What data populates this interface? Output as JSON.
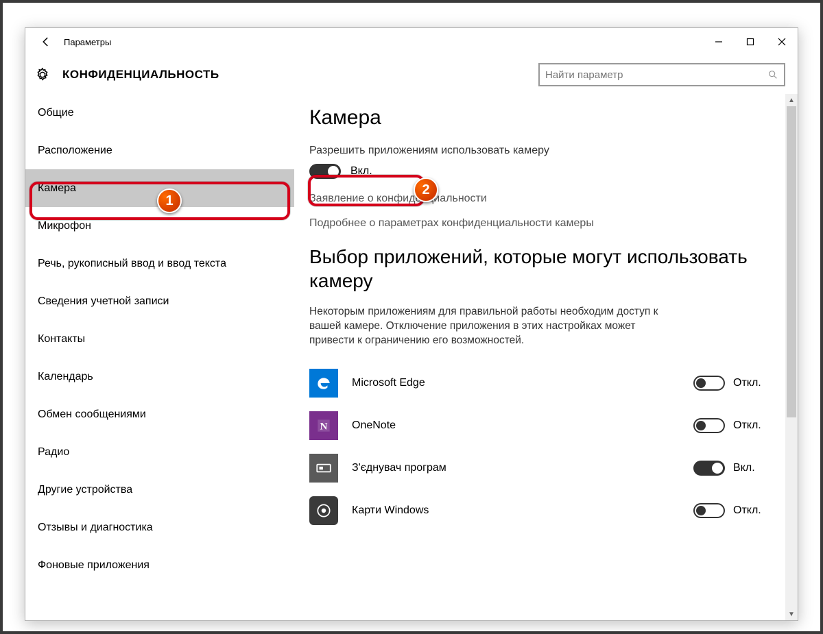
{
  "titlebar": {
    "title": "Параметры"
  },
  "header": {
    "page_title": "КОНФИДЕНЦИАЛЬНОСТЬ",
    "search_placeholder": "Найти параметр"
  },
  "sidebar": {
    "items": [
      {
        "label": "Общие"
      },
      {
        "label": "Расположение"
      },
      {
        "label": "Камера"
      },
      {
        "label": "Микрофон"
      },
      {
        "label": "Речь, рукописный ввод и ввод текста"
      },
      {
        "label": "Сведения учетной записи"
      },
      {
        "label": "Контакты"
      },
      {
        "label": "Календарь"
      },
      {
        "label": "Обмен сообщениями"
      },
      {
        "label": "Радио"
      },
      {
        "label": "Другие устройства"
      },
      {
        "label": "Отзывы и диагностика"
      },
      {
        "label": "Фоновые приложения"
      }
    ],
    "selected_index": 2
  },
  "content": {
    "heading": "Камера",
    "allow_label": "Разрешить приложениям использовать камеру",
    "allow_state_label": "Вкл.",
    "allow_state_on": true,
    "privacy_stmt": "Заявление о конфиденциальности",
    "more_info": "Подробнее о параметрах конфиденциальности камеры",
    "section2_heading": "Выбор приложений, которые могут использовать камеру",
    "section2_desc": "Некоторым приложениям для правильной работы необходим доступ к вашей камере. Отключение приложения в этих настройках может привести к ограничению его возможностей.",
    "apps": [
      {
        "name": "Microsoft Edge",
        "icon": "edge",
        "on": false,
        "state_label": "Откл."
      },
      {
        "name": "OneNote",
        "icon": "onenote",
        "on": false,
        "state_label": "Откл."
      },
      {
        "name": "З'єднувач програм",
        "icon": "connector",
        "on": true,
        "state_label": "Вкл."
      },
      {
        "name": "Карти Windows",
        "icon": "maps",
        "on": false,
        "state_label": "Откл."
      }
    ]
  },
  "annotations": {
    "badge1": "1",
    "badge2": "2"
  }
}
